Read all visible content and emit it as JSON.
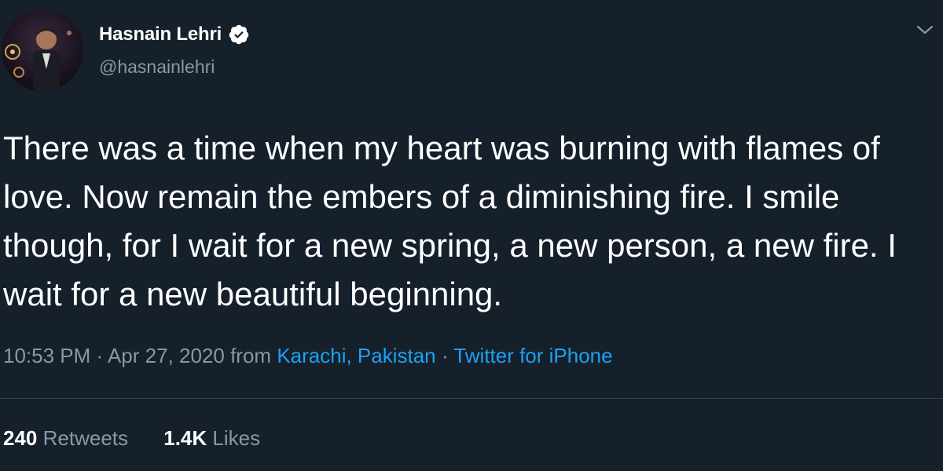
{
  "tweet": {
    "author": {
      "display_name": "Hasnain Lehri",
      "handle": "@hasnainlehri",
      "verified": true
    },
    "text": "There was a time when my heart was burning with flames of love. Now remain the embers of a diminishing fire. I smile though, for I wait for a new spring, a new person, a new fire. I wait for a new beautiful beginning.",
    "meta": {
      "time": "10:53 PM",
      "separator": " · ",
      "date": "Apr 27, 2020",
      "from_label": " from ",
      "location": "Karachi, Pakistan",
      "separator2": " · ",
      "source": "Twitter for iPhone"
    },
    "stats": {
      "retweets_count": "240",
      "retweets_label": "Retweets",
      "likes_count": "1.4K",
      "likes_label": "Likes"
    }
  },
  "colors": {
    "background": "#15202b",
    "primary_text": "#ffffff",
    "secondary_text": "#8899a6",
    "link": "#1da1f2",
    "divider": "#38444d"
  },
  "icons": {
    "verified": "verified-badge-icon",
    "menu": "chevron-down-icon"
  }
}
